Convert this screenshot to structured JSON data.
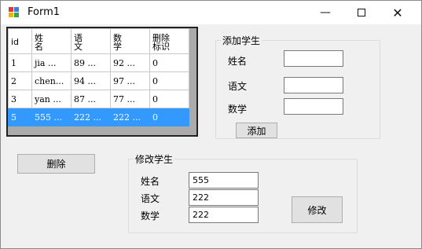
{
  "window": {
    "title": "Form1"
  },
  "grid": {
    "headers": [
      "id",
      "姓\n名",
      "语\n文",
      "数\n学",
      "删除\n标识"
    ],
    "rows": [
      [
        "1",
        "jia ...",
        "89  ...",
        "92  ...",
        "0"
      ],
      [
        "2",
        "chen...",
        "94  ...",
        "97  ...",
        "0"
      ],
      [
        "3",
        "yan ...",
        "87  ...",
        "77  ...",
        "0"
      ],
      [
        "5",
        "555 ...",
        "222 ...",
        "222 ...",
        "0"
      ]
    ],
    "selected_row": 3
  },
  "add_group": {
    "title": "添加学生",
    "name_label": "姓名",
    "chinese_label": "语文",
    "math_label": "数学",
    "name_value": "",
    "chinese_value": "",
    "math_value": "",
    "add_button": "添加"
  },
  "delete_button": "删除",
  "edit_group": {
    "title": "修改学生",
    "name_label": "姓名",
    "chinese_label": "语文",
    "math_label": "数学",
    "name_value": "555",
    "chinese_value": "222",
    "math_value": "222",
    "edit_button": "修改"
  },
  "colors": {
    "selection": "#3399ff",
    "window_bg": "#f0f0f0",
    "titlebar_bg": "#ffffff"
  }
}
